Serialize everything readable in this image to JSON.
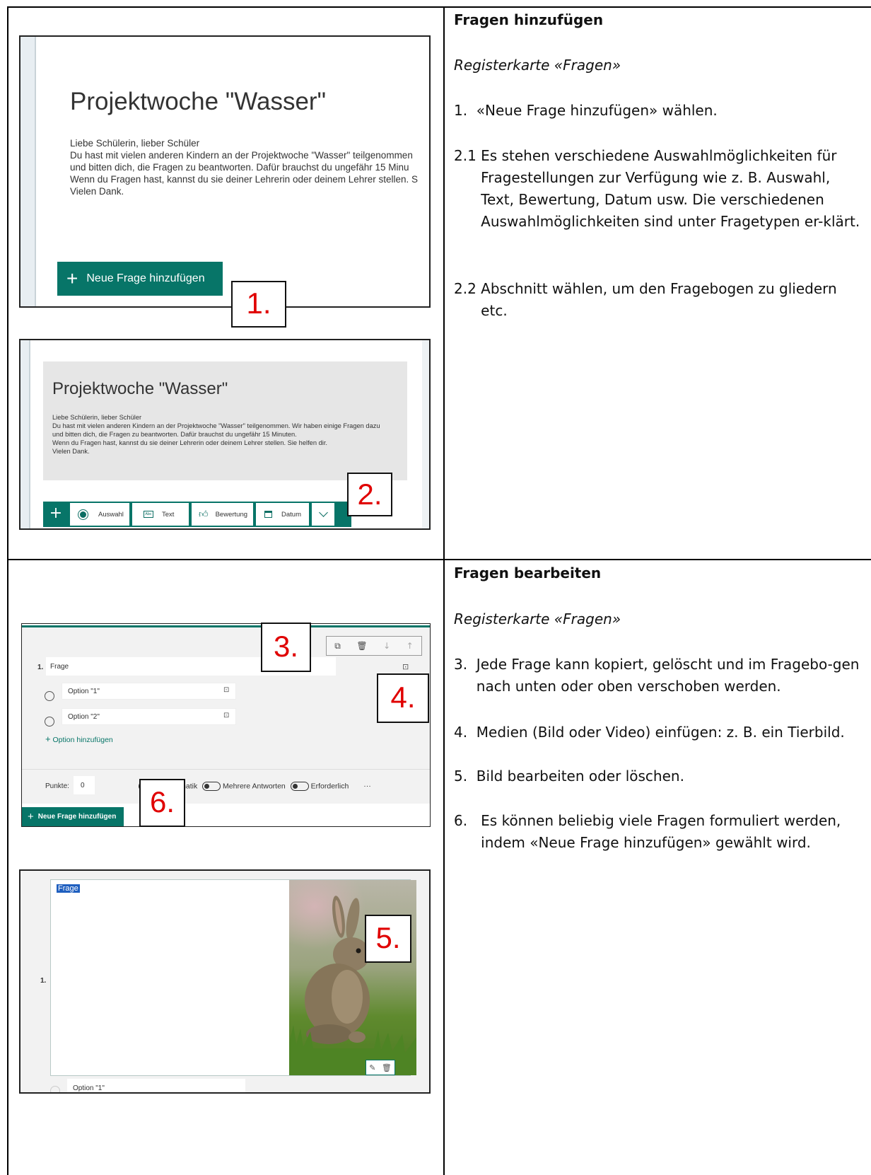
{
  "section1": {
    "heading": "Fragen hinzufügen",
    "subheading": "Registerkarte «Fragen»",
    "steps": [
      {
        "num": "1.  ",
        "text": "«Neue Frage hinzufügen» wählen."
      },
      {
        "num": "2.1 ",
        "text": "Es stehen verschiedene Auswahlmöglichkeiten für Fragestellungen zur Verfügung wie z. B. Auswahl, Text, Bewertung, Datum usw. Die verschiedenen Auswahlmöglichkeiten sind unter Fragetypen er-klärt."
      },
      {
        "num": "2.2 ",
        "text": "Abschnitt wählen, um den Fragebogen zu gliedern etc."
      }
    ],
    "shot1": {
      "title": "Projektwoche \"Wasser\"",
      "body": [
        "Liebe Schülerin, lieber Schüler",
        "Du hast mit vielen anderen Kindern an der Projektwoche \"Wasser\" teilgenommen",
        "und bitten dich, die Fragen zu beantworten. Dafür brauchst du ungefähr 15 Minu",
        "Wenn du Fragen hast, kannst du sie deiner Lehrerin oder deinem Lehrer stellen. S",
        "Vielen Dank."
      ],
      "button_label": "Neue Frage hinzufügen",
      "callout": "1."
    },
    "shot2": {
      "title": "Projektwoche \"Wasser\"",
      "body": [
        "Liebe Schülerin, lieber Schüler",
        "Du hast mit vielen anderen Kindern an der Projektwoche \"Wasser\" teilgenommen. Wir haben einige Fragen dazu",
        "und bitten dich, die Fragen zu beantworten. Dafür brauchst du ungefähr 15 Minuten.",
        "Wenn du Fragen hast, kannst du sie deiner Lehrerin oder deinem Lehrer stellen. Sie helfen dir.",
        "Vielen Dank."
      ],
      "types": [
        "Auswahl",
        "Text",
        "Bewertung",
        "Datum"
      ],
      "callout": "2."
    }
  },
  "section2": {
    "heading": "Fragen bearbeiten",
    "subheading": "Registerkarte «Fragen»",
    "steps": [
      {
        "num": "3.  ",
        "text": "Jede Frage kann kopiert, gelöscht und im Fragebo-gen nach unten oder oben verschoben werden."
      },
      {
        "num": "4.  ",
        "text": "Medien (Bild oder Video) einfügen: z. B. ein Tierbild."
      },
      {
        "num": "5.  ",
        "text": "Bild bearbeiten oder löschen."
      },
      {
        "num": "6.   ",
        "text": "Es können beliebig viele Fragen formuliert werden, indem «Neue Frage hinzufügen» gewählt wird."
      }
    ],
    "shot3": {
      "question_num": "1.",
      "question": "Frage",
      "options": [
        "Option \"1\"",
        "Option \"2\""
      ],
      "add_option": "Option hinzufügen",
      "points_label": "Punkte:",
      "points_value": "0",
      "toggles": [
        "Mathematik",
        "Mehrere Antworten",
        "Erforderlich"
      ],
      "more": "···",
      "button_label": "Neue Frage hinzufügen",
      "callouts": [
        "3.",
        "4.",
        "6."
      ]
    },
    "shot4": {
      "question_text": "Frage",
      "question_num": "1.",
      "option": "Option \"1\"",
      "callout": "5."
    }
  },
  "colors": {
    "accent": "#077568",
    "callout_text": "#e00000"
  }
}
